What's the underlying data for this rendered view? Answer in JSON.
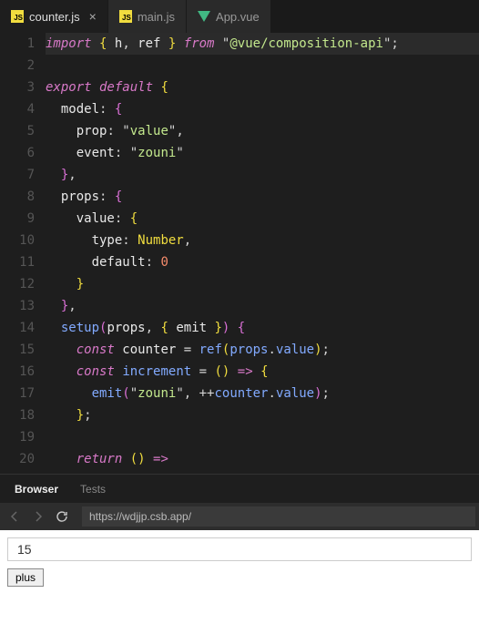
{
  "tabs": [
    {
      "label": "counter.js",
      "type": "js",
      "active": true,
      "closeable": true
    },
    {
      "label": "main.js",
      "type": "js",
      "active": false,
      "closeable": false
    },
    {
      "label": "App.vue",
      "type": "vue",
      "active": false,
      "closeable": false
    }
  ],
  "code": {
    "lines": [
      [
        {
          "t": "import ",
          "c": "tok-key"
        },
        {
          "t": "{",
          "c": "tok-brace"
        },
        {
          "t": " h",
          "c": "tok-id"
        },
        {
          "t": ",",
          "c": "tok-punc"
        },
        {
          "t": " ref ",
          "c": "tok-id"
        },
        {
          "t": "}",
          "c": "tok-brace"
        },
        {
          "t": " from ",
          "c": "tok-key"
        },
        {
          "t": "\"",
          "c": "tok-strq"
        },
        {
          "t": "@vue/composition-api",
          "c": "tok-str"
        },
        {
          "t": "\"",
          "c": "tok-strq"
        },
        {
          "t": ";",
          "c": "tok-punc"
        }
      ],
      [],
      [
        {
          "t": "export default ",
          "c": "tok-key"
        },
        {
          "t": "{",
          "c": "tok-brace"
        }
      ],
      [
        {
          "t": "  model",
          "c": "tok-id"
        },
        {
          "t": ": ",
          "c": "tok-punc"
        },
        {
          "t": "{",
          "c": "tok-brace2"
        }
      ],
      [
        {
          "t": "    prop",
          "c": "tok-id"
        },
        {
          "t": ": ",
          "c": "tok-punc"
        },
        {
          "t": "\"",
          "c": "tok-strq"
        },
        {
          "t": "value",
          "c": "tok-str"
        },
        {
          "t": "\"",
          "c": "tok-strq"
        },
        {
          "t": ",",
          "c": "tok-punc"
        }
      ],
      [
        {
          "t": "    event",
          "c": "tok-id"
        },
        {
          "t": ": ",
          "c": "tok-punc"
        },
        {
          "t": "\"",
          "c": "tok-strq"
        },
        {
          "t": "zouni",
          "c": "tok-str"
        },
        {
          "t": "\"",
          "c": "tok-strq"
        }
      ],
      [
        {
          "t": "  }",
          "c": "tok-brace2"
        },
        {
          "t": ",",
          "c": "tok-punc"
        }
      ],
      [
        {
          "t": "  props",
          "c": "tok-id"
        },
        {
          "t": ": ",
          "c": "tok-punc"
        },
        {
          "t": "{",
          "c": "tok-brace2"
        }
      ],
      [
        {
          "t": "    value",
          "c": "tok-id"
        },
        {
          "t": ": ",
          "c": "tok-punc"
        },
        {
          "t": "{",
          "c": "tok-brace"
        }
      ],
      [
        {
          "t": "      type",
          "c": "tok-id"
        },
        {
          "t": ": ",
          "c": "tok-punc"
        },
        {
          "t": "Number",
          "c": "tok-type"
        },
        {
          "t": ",",
          "c": "tok-punc"
        }
      ],
      [
        {
          "t": "      default",
          "c": "tok-id"
        },
        {
          "t": ": ",
          "c": "tok-punc"
        },
        {
          "t": "0",
          "c": "tok-num"
        }
      ],
      [
        {
          "t": "    }",
          "c": "tok-brace"
        }
      ],
      [
        {
          "t": "  }",
          "c": "tok-brace2"
        },
        {
          "t": ",",
          "c": "tok-punc"
        }
      ],
      [
        {
          "t": "  ",
          "c": "tok-id"
        },
        {
          "t": "setup",
          "c": "tok-func"
        },
        {
          "t": "(",
          "c": "tok-brace2"
        },
        {
          "t": "props",
          "c": "tok-id"
        },
        {
          "t": ", ",
          "c": "tok-punc"
        },
        {
          "t": "{",
          "c": "tok-brace"
        },
        {
          "t": " emit ",
          "c": "tok-id"
        },
        {
          "t": "}",
          "c": "tok-brace"
        },
        {
          "t": ")",
          "c": "tok-brace2"
        },
        {
          "t": " ",
          "c": "tok-punc"
        },
        {
          "t": "{",
          "c": "tok-brace2"
        }
      ],
      [
        {
          "t": "    ",
          "c": "tok-id"
        },
        {
          "t": "const",
          "c": "tok-decl"
        },
        {
          "t": " counter ",
          "c": "tok-id"
        },
        {
          "t": "=",
          "c": "tok-punc"
        },
        {
          "t": " ",
          "c": "tok-id"
        },
        {
          "t": "ref",
          "c": "tok-func"
        },
        {
          "t": "(",
          "c": "tok-brace"
        },
        {
          "t": "props",
          "c": "tok-func"
        },
        {
          "t": ".",
          "c": "tok-punc"
        },
        {
          "t": "value",
          "c": "tok-func"
        },
        {
          "t": ")",
          "c": "tok-brace"
        },
        {
          "t": ";",
          "c": "tok-punc"
        }
      ],
      [
        {
          "t": "    ",
          "c": "tok-id"
        },
        {
          "t": "const",
          "c": "tok-decl"
        },
        {
          "t": " ",
          "c": "tok-id"
        },
        {
          "t": "increment",
          "c": "tok-func"
        },
        {
          "t": " = ",
          "c": "tok-punc"
        },
        {
          "t": "()",
          "c": "tok-brace"
        },
        {
          "t": " ",
          "c": "tok-punc"
        },
        {
          "t": "=>",
          "c": "tok-arrow"
        },
        {
          "t": " ",
          "c": "tok-punc"
        },
        {
          "t": "{",
          "c": "tok-brace"
        }
      ],
      [
        {
          "t": "      ",
          "c": "tok-id"
        },
        {
          "t": "emit",
          "c": "tok-func"
        },
        {
          "t": "(",
          "c": "tok-brace2"
        },
        {
          "t": "\"",
          "c": "tok-strq"
        },
        {
          "t": "zouni",
          "c": "tok-str"
        },
        {
          "t": "\"",
          "c": "tok-strq"
        },
        {
          "t": ", ++",
          "c": "tok-punc"
        },
        {
          "t": "counter",
          "c": "tok-func"
        },
        {
          "t": ".",
          "c": "tok-punc"
        },
        {
          "t": "value",
          "c": "tok-func"
        },
        {
          "t": ")",
          "c": "tok-brace2"
        },
        {
          "t": ";",
          "c": "tok-punc"
        }
      ],
      [
        {
          "t": "    }",
          "c": "tok-brace"
        },
        {
          "t": ";",
          "c": "tok-punc"
        }
      ],
      [],
      [
        {
          "t": "    ",
          "c": "tok-id"
        },
        {
          "t": "return",
          "c": "tok-decl"
        },
        {
          "t": " ",
          "c": "tok-id"
        },
        {
          "t": "()",
          "c": "tok-brace"
        },
        {
          "t": " ",
          "c": "tok-punc"
        },
        {
          "t": "=>",
          "c": "tok-arrow"
        }
      ]
    ],
    "highlighted_line_index": 0
  },
  "panels": [
    {
      "label": "Browser",
      "active": true
    },
    {
      "label": "Tests",
      "active": false
    }
  ],
  "url_bar": {
    "value": "https://wdjjp.csb.app/"
  },
  "preview": {
    "counter_value": "15",
    "button_label": "plus"
  }
}
